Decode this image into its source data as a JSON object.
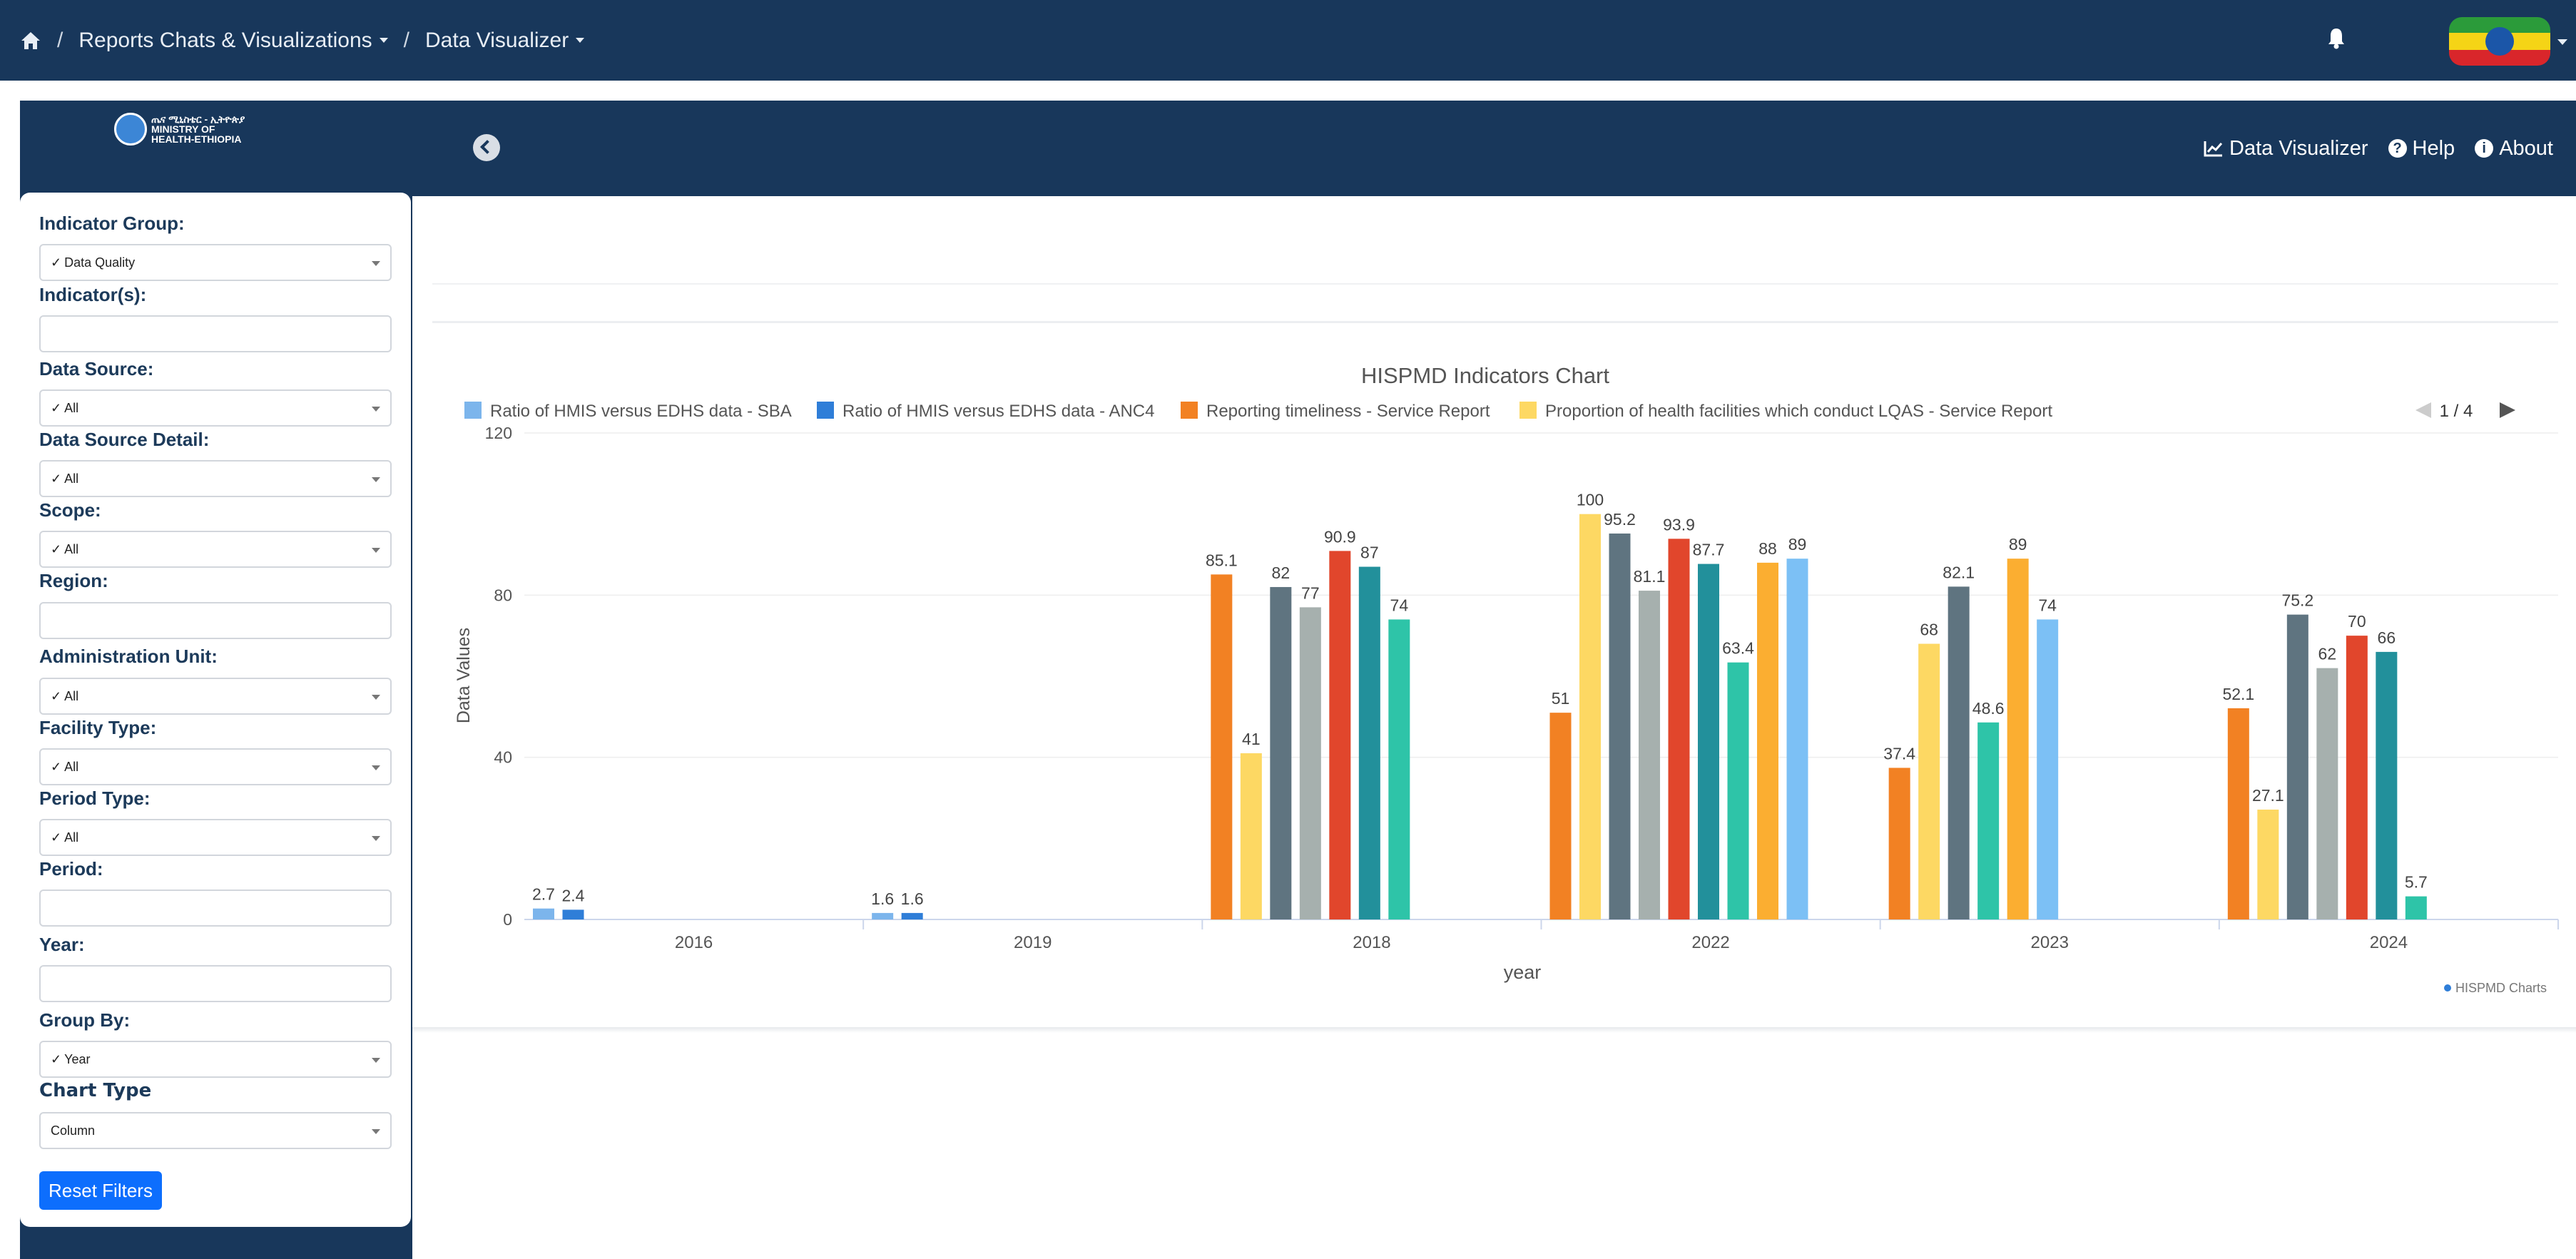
{
  "topnav": {
    "home_sep": "/",
    "crumb1": "Reports Chats & Visualizations",
    "sep2": "/",
    "crumb2": "Data Visualizer"
  },
  "colors": {
    "navy": "#18375b",
    "button_blue": "#0d6efd"
  },
  "logo": {
    "text": "ጤና ሚኒስቴር - ኢትዮጵያ MINISTRY OF HEALTH-ETHIOPIA"
  },
  "header": {
    "links": [
      "Data Visualizer",
      "Help",
      "About"
    ]
  },
  "filters": {
    "indicator_group": {
      "label": "Indicator Group:",
      "value": "Data Quality"
    },
    "indicators": {
      "label": "Indicator(s):",
      "value": ""
    },
    "data_source": {
      "label": "Data Source:",
      "value": "All"
    },
    "data_source_detail": {
      "label": "Data Source Detail:",
      "value": "All"
    },
    "scope": {
      "label": "Scope:",
      "value": "All"
    },
    "region": {
      "label": "Region:",
      "value": ""
    },
    "admin_unit": {
      "label": "Administration Unit:",
      "value": "All"
    },
    "facility_type": {
      "label": "Facility Type:",
      "value": "All"
    },
    "period_type": {
      "label": "Period Type:",
      "value": "All"
    },
    "period": {
      "label": "Period:",
      "value": ""
    },
    "year": {
      "label": "Year:",
      "value": ""
    },
    "group_by": {
      "label": "Group By:",
      "value": "Year"
    },
    "chart_type": {
      "label": "Chart Type",
      "value": "Column"
    },
    "reset_label": "Reset Filters"
  },
  "chart_data": {
    "type": "bar",
    "title": "HISPMD Indicators Chart",
    "xlabel": "year",
    "ylabel": "Data Values",
    "ylim": [
      0,
      120
    ],
    "yticks": [
      0,
      40,
      80,
      120
    ],
    "categories": [
      "2016",
      "2019",
      "2018",
      "2022",
      "2023",
      "2024"
    ],
    "legend": {
      "position": "top",
      "page": "1 / 4",
      "visible_entries": [
        {
          "name": "Ratio of HMIS versus EDHS data - SBA",
          "color": "#7cb5ec"
        },
        {
          "name": "Ratio of HMIS versus EDHS data - ANC4",
          "color": "#2f7ed8"
        },
        {
          "name": "Reporting timeliness - Service Report",
          "color": "#f28123"
        },
        {
          "name": "Proportion of health facilities which conduct LQAS - Service Report",
          "color": "#fdd863"
        }
      ]
    },
    "groups": [
      {
        "category": "2016",
        "bars": [
          {
            "value": 2.7,
            "label": "2.7",
            "color": "#7cb5ec"
          },
          {
            "value": 2.4,
            "label": "2.4",
            "color": "#2f7ed8"
          }
        ]
      },
      {
        "category": "2019",
        "bars": [
          {
            "value": 1.6,
            "label": "1.6",
            "color": "#7cb5ec"
          },
          {
            "value": 1.6,
            "label": "1.6",
            "color": "#2f7ed8"
          }
        ]
      },
      {
        "category": "2018",
        "bars": [
          {
            "value": 85.1,
            "label": "85.1",
            "color": "#f28123"
          },
          {
            "value": 41,
            "label": "41",
            "color": "#fdd863"
          },
          {
            "value": 82,
            "label": "82",
            "color": "#5f7480"
          },
          {
            "value": 77,
            "label": "77",
            "color": "#a6b0ae"
          },
          {
            "value": 90.9,
            "label": "90.9",
            "color": "#e1462c"
          },
          {
            "value": 87,
            "label": "87",
            "color": "#22909b"
          },
          {
            "value": 74,
            "label": "74",
            "color": "#2ec4a8"
          }
        ]
      },
      {
        "category": "2022",
        "bars": [
          {
            "value": 51,
            "label": "51",
            "color": "#f28123"
          },
          {
            "value": 100,
            "label": "100",
            "color": "#fdd863"
          },
          {
            "value": 95.2,
            "label": "95.2",
            "color": "#5f7480"
          },
          {
            "value": 81.1,
            "label": "81.1",
            "color": "#a6b0ae"
          },
          {
            "value": 93.9,
            "label": "93.9",
            "color": "#e1462c"
          },
          {
            "value": 87.7,
            "label": "87.7",
            "color": "#22909b"
          },
          {
            "value": 63.4,
            "label": "63.4",
            "color": "#2ec4a8"
          },
          {
            "value": 88,
            "label": "88",
            "color": "#fbae31"
          },
          {
            "value": 89,
            "label": "89",
            "color": "#7cc0f5"
          }
        ]
      },
      {
        "category": "2023",
        "bars": [
          {
            "value": 37.4,
            "label": "37.4",
            "color": "#f28123"
          },
          {
            "value": 68,
            "label": "68",
            "color": "#fdd863"
          },
          {
            "value": 82.1,
            "label": "82.1",
            "color": "#5f7480"
          },
          {
            "value": 48.6,
            "label": "48.6",
            "color": "#2ec4a8"
          },
          {
            "value": 89,
            "label": "89",
            "color": "#fbae31"
          },
          {
            "value": 74,
            "label": "74",
            "color": "#7cc0f5"
          }
        ]
      },
      {
        "category": "2024",
        "bars": [
          {
            "value": 52.1,
            "label": "52.1",
            "color": "#f28123"
          },
          {
            "value": 27.1,
            "label": "27.1",
            "color": "#fdd863"
          },
          {
            "value": 75.2,
            "label": "75.2",
            "color": "#5f7480"
          },
          {
            "value": 62,
            "label": "62",
            "color": "#a6b0ae"
          },
          {
            "value": 70,
            "label": "70",
            "color": "#e1462c"
          },
          {
            "value": 66,
            "label": "66",
            "color": "#22909b"
          },
          {
            "value": 5.7,
            "label": "5.7",
            "color": "#2ec4a8"
          }
        ]
      }
    ],
    "credits": "HISPMD Charts"
  }
}
